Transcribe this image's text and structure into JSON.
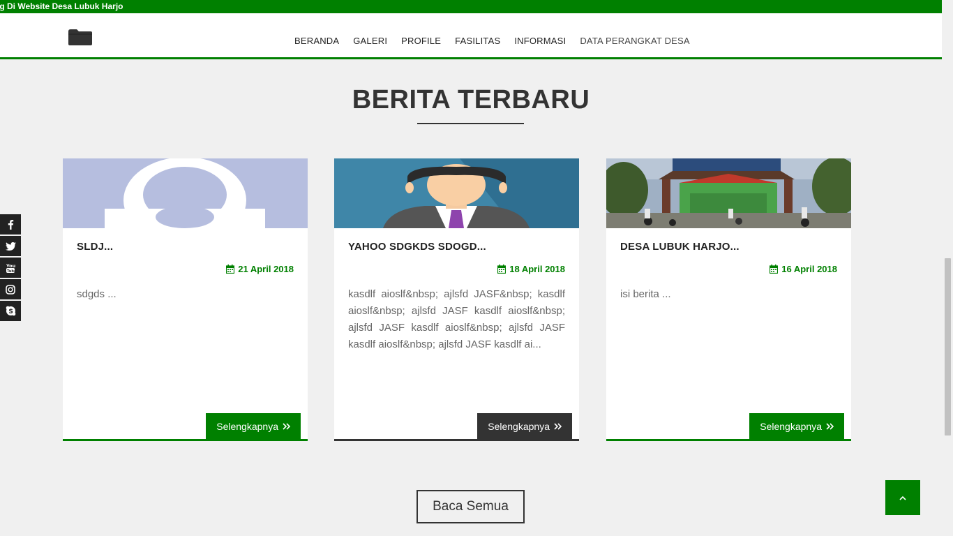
{
  "topbar": {
    "marquee_text": "ng Di Website Desa Lubuk Harjo",
    "bg_color": "#008000"
  },
  "header": {
    "logo_icon": "folder-icon",
    "nav": [
      {
        "label": "BERANDA"
      },
      {
        "label": "GALERI"
      },
      {
        "label": "PROFILE"
      },
      {
        "label": "FASILITAS"
      },
      {
        "label": "INFORMASI"
      },
      {
        "label": "DATA PERANGKAT DESA"
      }
    ]
  },
  "section": {
    "title": "BERITA TERBARU"
  },
  "cards": [
    {
      "title": "SLDJ...",
      "date": "21 April 2018",
      "excerpt": "sdgds ...",
      "button": "Selengkapnya",
      "image": "avatar-silhouette"
    },
    {
      "title": "YAHOO SDGKDS SDOGD...",
      "date": "18 April 2018",
      "excerpt": "kasdlf aioslf&nbsp; ajlsfd JASF&nbsp; kasdlf aioslf&nbsp; ajlsfd JASF kasdlf aioslf&nbsp; ajlsfd JASF kasdlf aioslf&nbsp; ajlsfd JASF kasdlf aioslf&nbsp; ajlsfd JASF kasdlf ai...",
      "button": "Selengkapnya",
      "image": "businessman-illustration"
    },
    {
      "title": "DESA LUBUK HARJO...",
      "date": "16 April 2018",
      "excerpt": "isi berita ...",
      "button": "Selengkapnya",
      "image": "school-gate-photo"
    }
  ],
  "social": [
    {
      "icon": "facebook-icon"
    },
    {
      "icon": "twitter-icon"
    },
    {
      "icon": "youtube-icon"
    },
    {
      "icon": "instagram-icon"
    },
    {
      "icon": "skype-icon"
    }
  ],
  "read_all": {
    "label": "Baca Semua"
  },
  "back_to_top": {
    "icon": "chevron-up-icon"
  },
  "colors": {
    "accent": "#008000",
    "dark": "#333333",
    "background": "#f0f0f0"
  }
}
